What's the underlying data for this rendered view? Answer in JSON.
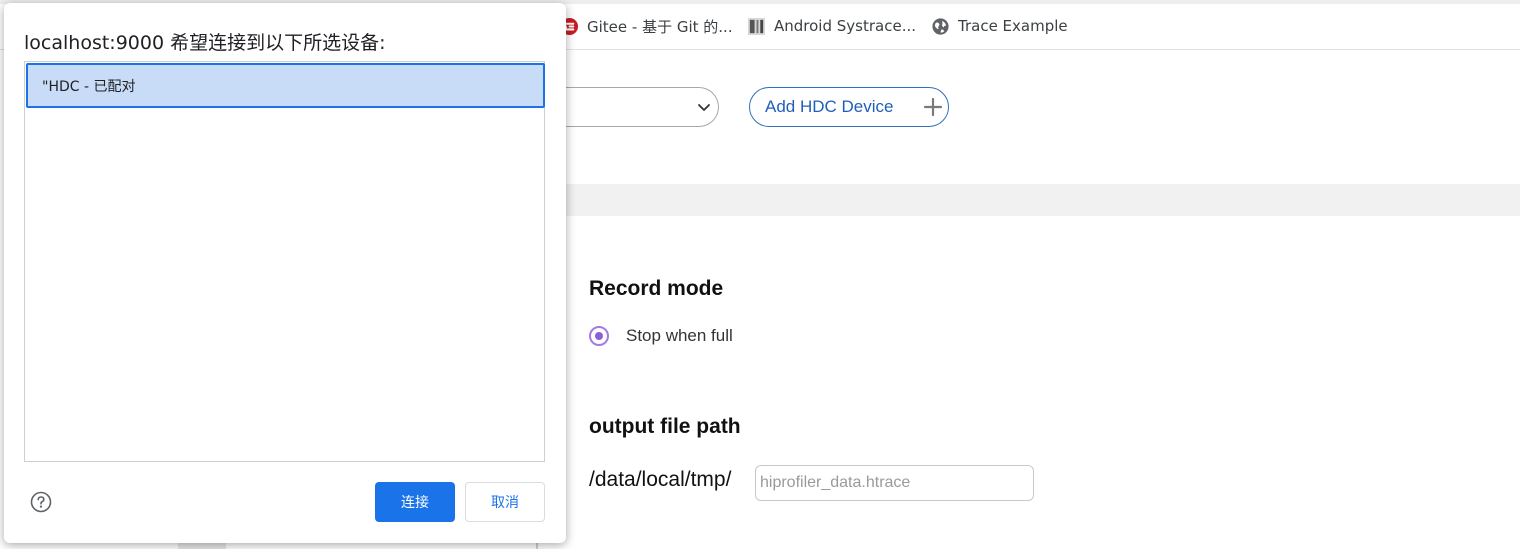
{
  "bookmarks": {
    "items": [
      {
        "label": "Gitee - 基于 Git 的...",
        "icon": "gitee-logo-icon",
        "color": "#c71d23"
      },
      {
        "label": "Android Systrace...",
        "icon": "systrace-thumbnail-icon"
      },
      {
        "label": "Trace Example",
        "icon": "globe-icon"
      }
    ]
  },
  "page": {
    "add_device_label": "Add HDC Device",
    "record_mode_title": "Record mode",
    "record_mode_option": "Stop when full",
    "output_title": "output file path",
    "path_prefix": "/data/local/tmp/",
    "path_placeholder": "hiprofiler_data.htrace",
    "accent_color": "#8d5fd6",
    "link_color": "#1f5fb8"
  },
  "dialog": {
    "title": "localhost:9000 希望连接到以下所选设备:",
    "devices": [
      {
        "label": "\"HDC - 已配对",
        "selected": true
      }
    ],
    "connect_label": "连接",
    "cancel_label": "取消",
    "primary_color": "#1a73e8"
  }
}
